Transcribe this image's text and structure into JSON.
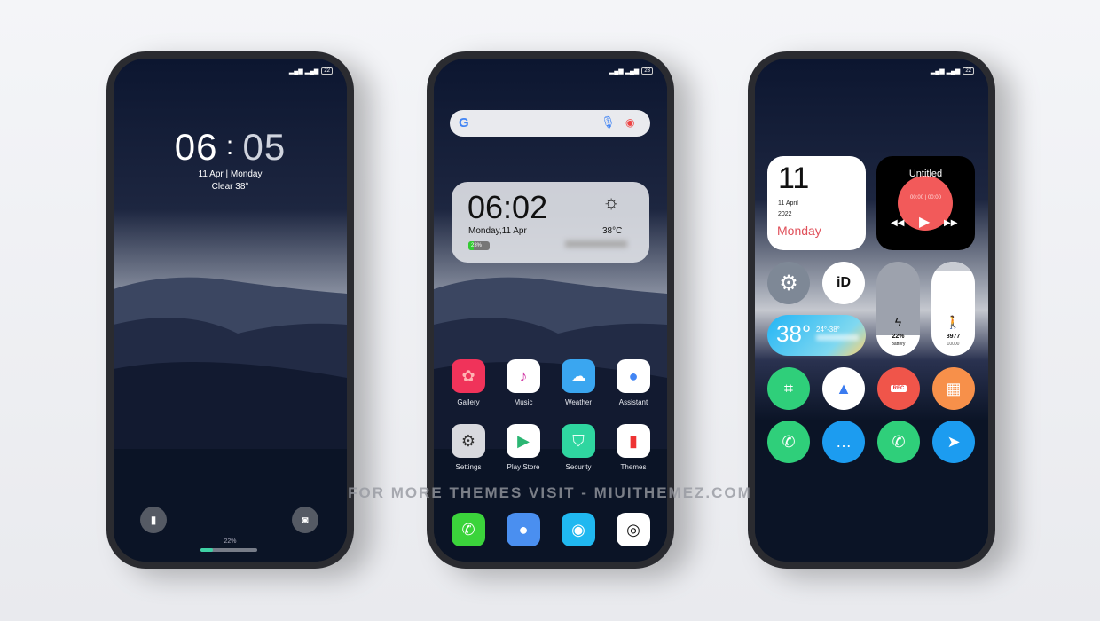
{
  "lockscreen": {
    "time_hour": "06",
    "time_min": "05",
    "date": "11 Apr | Monday",
    "weather": "Clear 38°",
    "battery_status": "22",
    "charge_percent": "22%",
    "charge_level": 0.22,
    "icons": [
      "flashlight-icon",
      "camera-icon"
    ]
  },
  "homescreen": {
    "battery_status": "23",
    "search_logo": "G",
    "clock": "06:02",
    "date": "Monday,11 Apr",
    "temperature": "38°C",
    "battery": "23%",
    "battery_level": 0.23,
    "apps": [
      {
        "label": "Gallery",
        "color": "#f0335a"
      },
      {
        "label": "Music",
        "color": "#ffffff"
      },
      {
        "label": "Weather",
        "color": "#3aa6f0"
      },
      {
        "label": "Assistant",
        "color": "#ffffff"
      },
      {
        "label": "Settings",
        "color": "#d8d9de"
      },
      {
        "label": "Play Store",
        "color": "#ffffff"
      },
      {
        "label": "Security",
        "color": "#2fd6a0"
      },
      {
        "label": "Themes",
        "color": "#ffffff"
      }
    ],
    "dock": [
      {
        "name": "phone",
        "color": "#3bd43b"
      },
      {
        "name": "messages",
        "color": "#4a8ff0"
      },
      {
        "name": "browser",
        "color": "#20b8f0"
      },
      {
        "name": "camera",
        "color": "#ffffff"
      }
    ]
  },
  "widgets": {
    "battery_status": "22",
    "day": "11",
    "date": "11 April",
    "year": "2022",
    "weekday": "Monday",
    "music_title": "Untitled",
    "music_time": "00:00 | 00:00",
    "temp": "38°",
    "temp_range": "24°-38°",
    "battery_percent": "22%",
    "battery_label": "Battery",
    "battery_level": 0.22,
    "steps": "8977",
    "steps_goal": "10000",
    "circles": [
      {
        "name": "scanner",
        "color": "#2fcf7a"
      },
      {
        "name": "gallery",
        "color": "#ffffff"
      },
      {
        "name": "recorder",
        "color": "#f0554a",
        "label": "REC"
      },
      {
        "name": "calculator",
        "color": "#f7904a"
      },
      {
        "name": "phone",
        "color": "#2fcf7a"
      },
      {
        "name": "messages",
        "color": "#1c9cf0"
      },
      {
        "name": "whatsapp",
        "color": "#2fcf7a"
      },
      {
        "name": "telegram",
        "color": "#1c9cf0"
      }
    ]
  },
  "watermark": "FOR MORE THEMES VISIT - MIUITHEMEZ.COM"
}
